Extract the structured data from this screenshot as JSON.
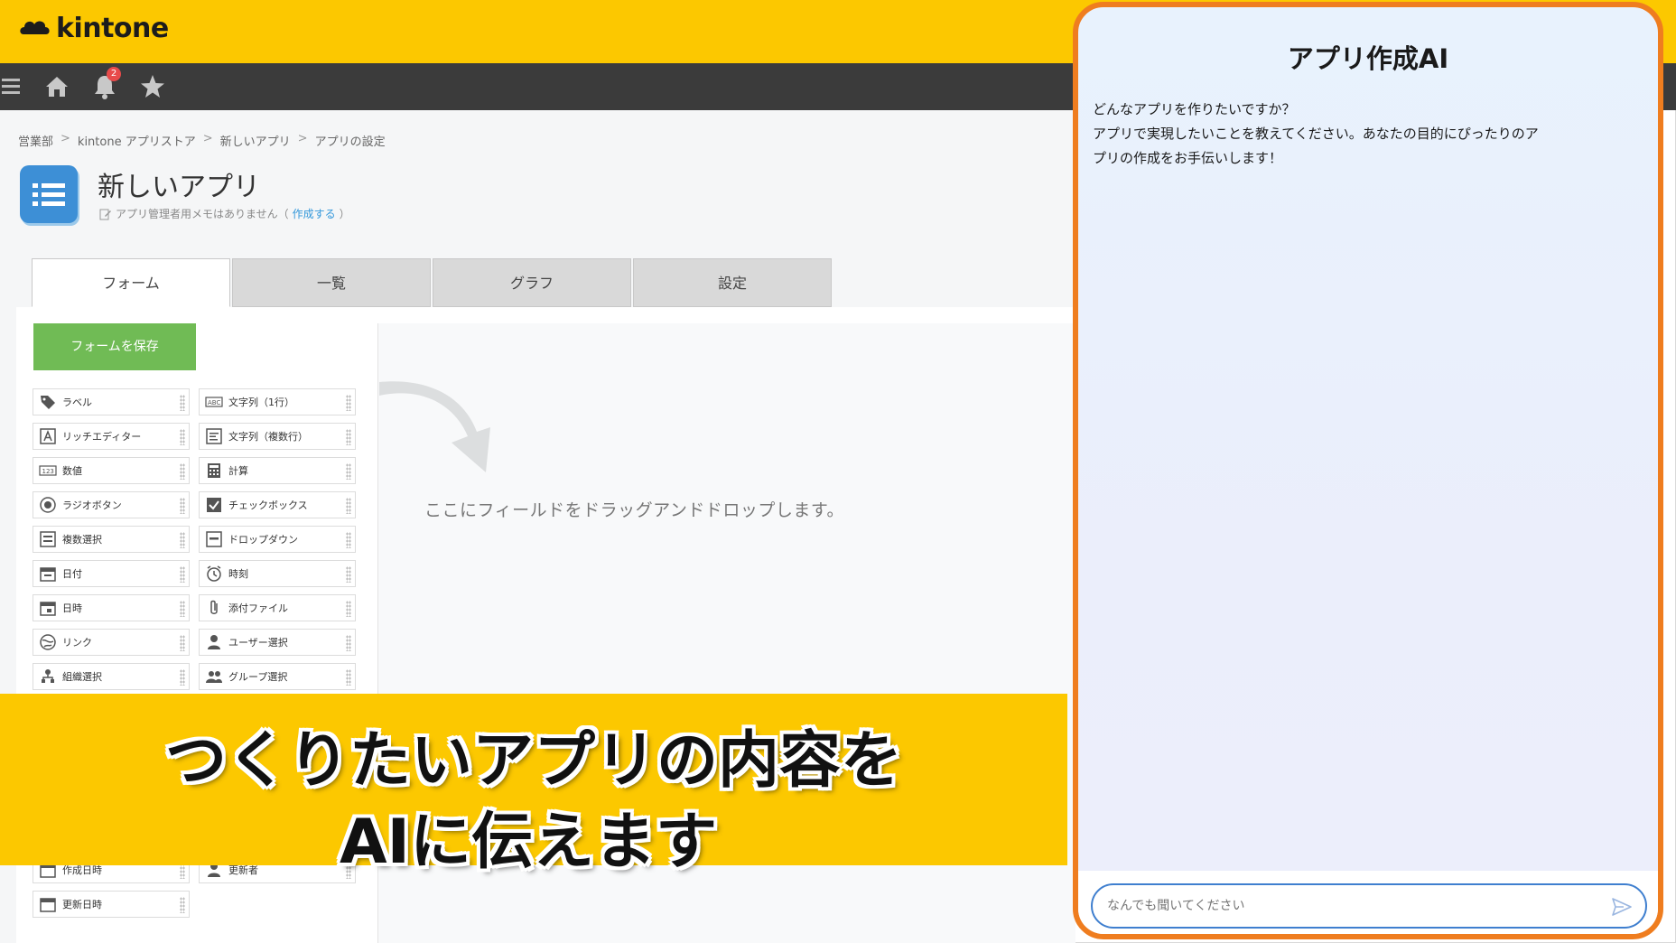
{
  "header": {
    "logo_text": "kintone",
    "brand_color": "#fcc800"
  },
  "navbar": {
    "notification_count": "2",
    "icons": [
      "menu-icon",
      "home-icon",
      "bell-icon",
      "star-icon"
    ]
  },
  "breadcrumb": [
    "営業部",
    "kintone アプリストア",
    "新しいアプリ",
    "アプリの設定"
  ],
  "breadcrumb_sep": ">",
  "app": {
    "title": "新しいアプリ",
    "memo_text": "アプリ管理者用メモはありません（",
    "memo_link": "作成する",
    "memo_close": "）"
  },
  "tabs": [
    {
      "label": "フォーム",
      "active": true
    },
    {
      "label": "一覧",
      "active": false
    },
    {
      "label": "グラフ",
      "active": false
    },
    {
      "label": "設定",
      "active": false
    }
  ],
  "form": {
    "save_label": "フォームを保存",
    "save_color": "#70bb55",
    "drop_text": "ここにフィールドをドラッグアンドドロップします。"
  },
  "palette": {
    "left": [
      "ラベル",
      "リッチエディター",
      "数値",
      "ラジオボタン",
      "複数選択",
      "日付",
      "日時",
      "リンク",
      "組織選択"
    ],
    "right": [
      "文字列（1行）",
      "文字列（複数行）",
      "計算",
      "チェックボックス",
      "ドロップダウン",
      "時刻",
      "添付ファイル",
      "ユーザー選択",
      "グループ選択"
    ],
    "bottom_left": [
      "作成日時",
      "更新日時"
    ],
    "bottom_right": [
      "更新者"
    ]
  },
  "ai_panel": {
    "title": "アプリ作成AI",
    "border_color": "#ef7d1f",
    "message_lines": [
      "どんなアプリを作りたいですか？",
      "アプリで実現したいことを教えてください。あなたの目的にぴったりのア",
      "プリの作成をお手伝いします！"
    ],
    "input_placeholder": "なんでも聞いてください"
  },
  "caption": {
    "line1": "つくりたいアプリの内容を",
    "line2": "AIに伝えます"
  }
}
